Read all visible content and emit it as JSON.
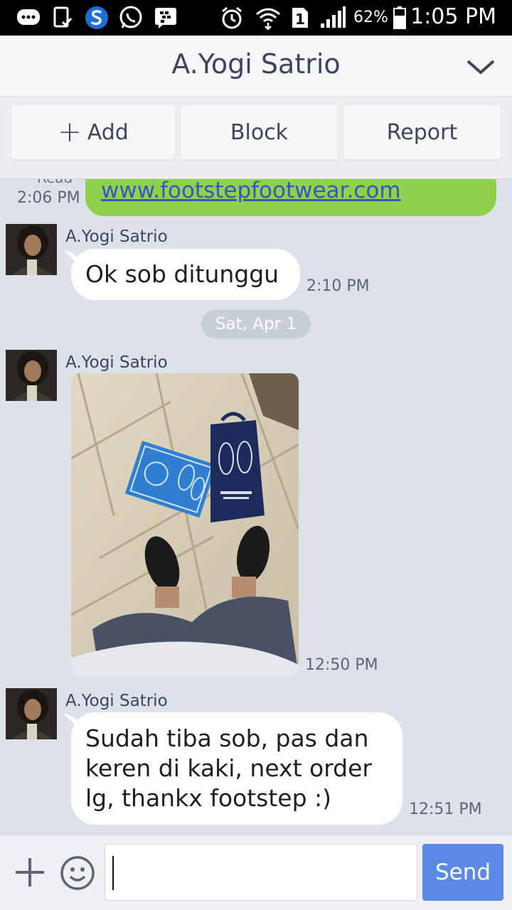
{
  "status_bar": {
    "battery_percent": "62%",
    "time": "1:05 PM",
    "sim_number": "1",
    "icons": [
      "chat-bubble-icon",
      "file-check-icon",
      "s-app-icon",
      "whatsapp-icon",
      "bbm-icon",
      "alarm-icon",
      "wifi-icon",
      "sim-icon",
      "signal-icon",
      "battery-icon"
    ]
  },
  "header": {
    "title": "A.Yogi Satrio",
    "dropdown_icon": "chevron-down-icon"
  },
  "actions": {
    "add_label": "Add",
    "block_label": "Block",
    "report_label": "Report"
  },
  "chat": {
    "sent_link": "www.footstepfootwear.com",
    "sent_read": "Read",
    "sent_time": "2:06 PM",
    "messages": [
      {
        "sender": "A.Yogi Satrio",
        "text": "Ok sob ditunggu",
        "time": "2:10 PM"
      },
      {
        "sender": "A.Yogi Satrio",
        "type": "photo",
        "time": "12:50 PM"
      },
      {
        "sender": "A.Yogi Satrio",
        "text_lines": [
          "Sudah tiba sob, pas dan",
          "keren di kaki, next order",
          "lg, thankx footstep :)"
        ],
        "time": "12:51 PM"
      }
    ],
    "date_separator": "Sat, Apr 1"
  },
  "input_bar": {
    "value": "",
    "send_label": "Send"
  },
  "colors": {
    "background": "#dde2ea",
    "sent_bubble": "#8dd24a",
    "send_button": "#5b8ae6",
    "header_text": "#3c4560"
  }
}
